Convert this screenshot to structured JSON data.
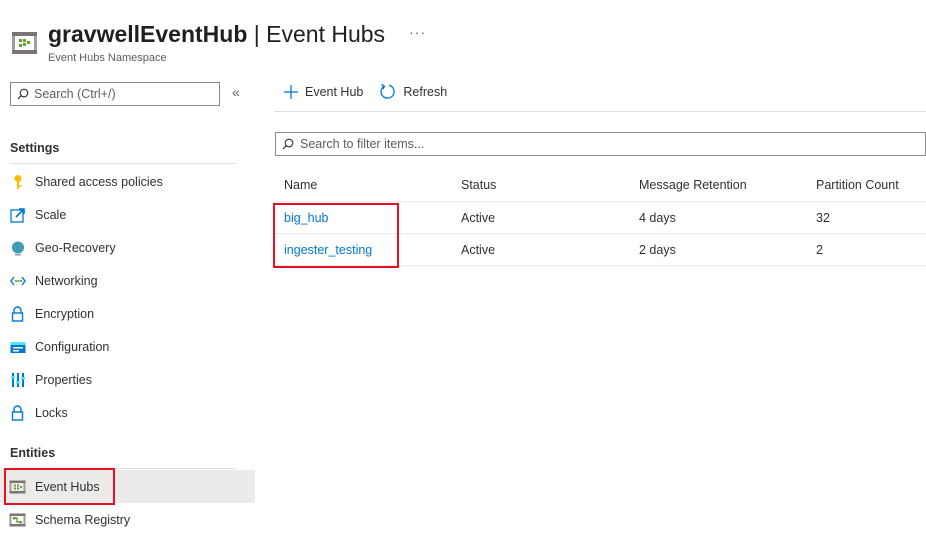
{
  "header": {
    "resource_name": "gravwellEventHub",
    "separator": " | ",
    "page_name": "Event Hubs",
    "subtitle": "Event Hubs Namespace",
    "more_label": "···"
  },
  "sidebar": {
    "search_placeholder": "Search (Ctrl+/)",
    "collapse_label": "«",
    "sections": [
      {
        "title": "Settings",
        "items": [
          {
            "label": "Shared access policies",
            "icon": "key-icon"
          },
          {
            "label": "Scale",
            "icon": "scale-icon"
          },
          {
            "label": "Geo-Recovery",
            "icon": "globe-icon"
          },
          {
            "label": "Networking",
            "icon": "networking-icon"
          },
          {
            "label": "Encryption",
            "icon": "lock-icon"
          },
          {
            "label": "Configuration",
            "icon": "configuration-icon"
          },
          {
            "label": "Properties",
            "icon": "properties-icon"
          },
          {
            "label": "Locks",
            "icon": "lock-icon"
          }
        ]
      },
      {
        "title": "Entities",
        "items": [
          {
            "label": "Event Hubs",
            "icon": "event-hubs-icon",
            "selected": true
          },
          {
            "label": "Schema Registry",
            "icon": "schema-registry-icon"
          }
        ]
      }
    ]
  },
  "toolbar": {
    "add_label": "Event Hub",
    "refresh_label": "Refresh"
  },
  "filter": {
    "placeholder": "Search to filter items..."
  },
  "table": {
    "columns": [
      "Name",
      "Status",
      "Message Retention",
      "Partition Count"
    ],
    "rows": [
      [
        "big_hub",
        "Active",
        "4 days",
        "32"
      ],
      [
        "ingester_testing",
        "Active",
        "2 days",
        "2"
      ]
    ]
  },
  "colors": {
    "link": "#0078d4",
    "highlight_box": "#e81123",
    "selected_bg": "#edebe9"
  }
}
